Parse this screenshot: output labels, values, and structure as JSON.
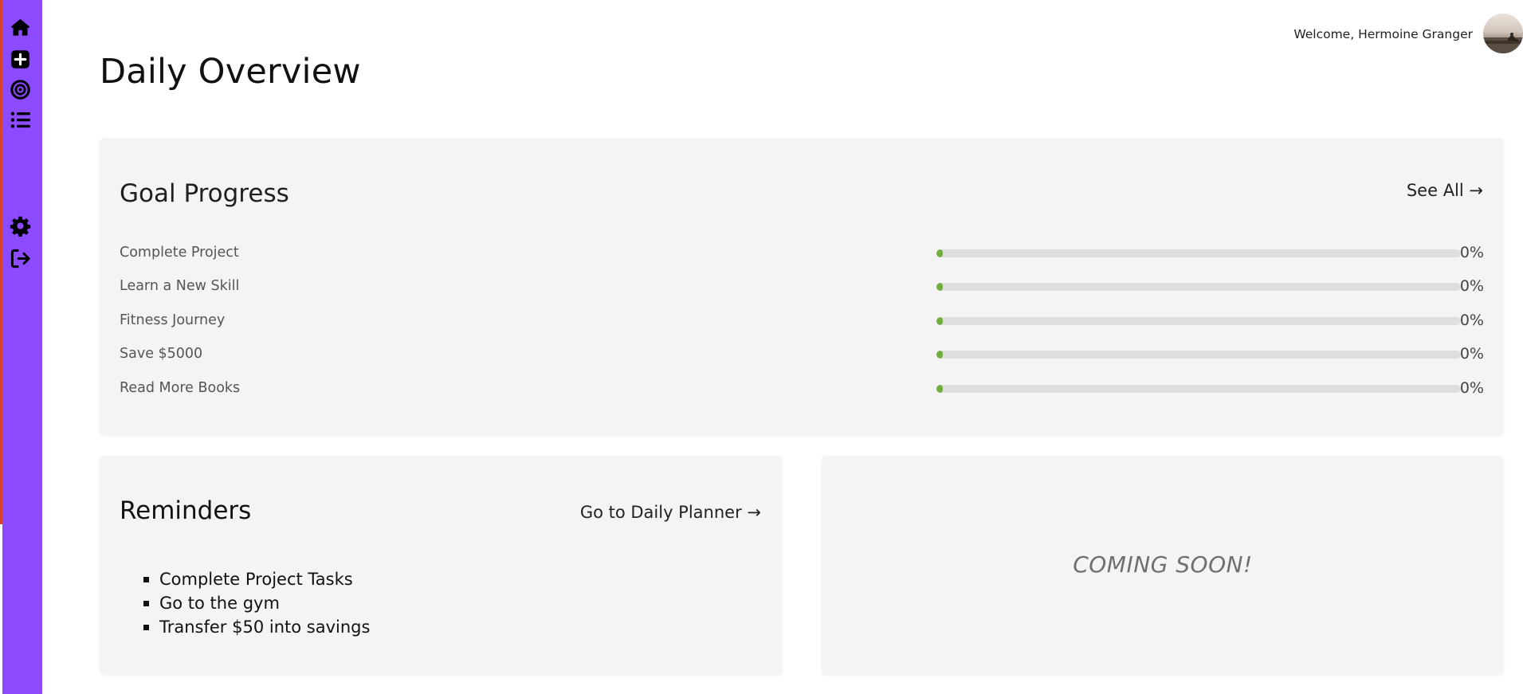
{
  "header": {
    "welcome_text": "Welcome, Hermoine Granger",
    "page_title": "Daily Overview"
  },
  "sidebar": {
    "color": "#8c4bff",
    "items": [
      {
        "icon": "home-icon"
      },
      {
        "icon": "add-square-icon"
      },
      {
        "icon": "target-icon"
      },
      {
        "icon": "list-icon"
      },
      {
        "icon": "gear-icon"
      },
      {
        "icon": "logout-icon"
      }
    ]
  },
  "goals": {
    "title": "Goal Progress",
    "see_all": "See All →",
    "progress_color": "#6fae3d",
    "items": [
      {
        "name": "Complete Project",
        "progress": 0,
        "pct_label": "0%"
      },
      {
        "name": "Learn a New Skill",
        "progress": 0,
        "pct_label": "0%"
      },
      {
        "name": "Fitness Journey",
        "progress": 0,
        "pct_label": "0%"
      },
      {
        "name": "Save $5000",
        "progress": 0,
        "pct_label": "0%"
      },
      {
        "name": "Read More Books",
        "progress": 0,
        "pct_label": "0%"
      }
    ]
  },
  "reminders": {
    "title": "Reminders",
    "planner_link": "Go to Daily Planner →",
    "items": [
      "Complete Project Tasks",
      "Go to the gym",
      "Transfer $50 into savings"
    ]
  },
  "placeholder": {
    "text": "COMING SOON!"
  }
}
